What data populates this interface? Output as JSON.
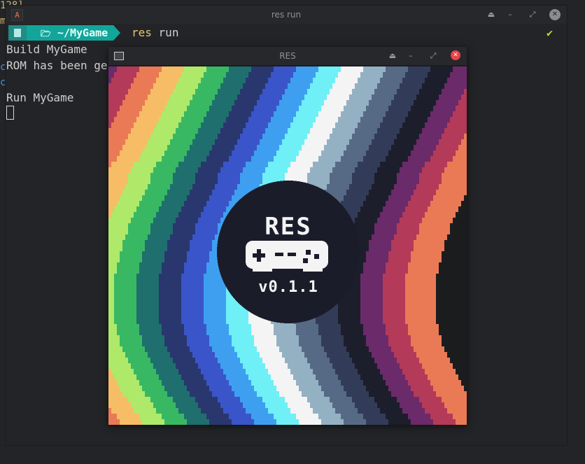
{
  "background": {
    "fragments": [
      "128]",
      "m",
      "c",
      "c"
    ]
  },
  "terminal": {
    "title": "res run",
    "logo_glyph": "A",
    "controls": {
      "eject": "⏏",
      "minimize": "–",
      "restore": "⤢",
      "close": "✕"
    },
    "prompt": {
      "path": "~/MyGame",
      "folder_glyph": "🗁",
      "command_keyword": "res",
      "command_arg": "run",
      "status_glyph": "✔"
    },
    "output": [
      "Build MyGame",
      "ROM has been ge",
      "",
      "Run MyGame"
    ]
  },
  "res_window": {
    "title": "RES",
    "controls": {
      "eject": "⏏",
      "minimize": "–",
      "restore": "⤢",
      "close": "✕"
    },
    "splash": {
      "logo_text": "RES",
      "version": "v0.1.1"
    }
  },
  "colors": {
    "stripes": [
      "#6b2a6a",
      "#b43a5a",
      "#ea7a55",
      "#f6bd66",
      "#aee96a",
      "#39b863",
      "#1f6f6e",
      "#29376e",
      "#3a55c9",
      "#3e9ff0",
      "#6ef0f6",
      "#f4f4f4",
      "#94b1c4",
      "#576a85",
      "#323c58",
      "#1d1e2c"
    ],
    "accent": "#12a59a",
    "close": "#e8434a"
  }
}
